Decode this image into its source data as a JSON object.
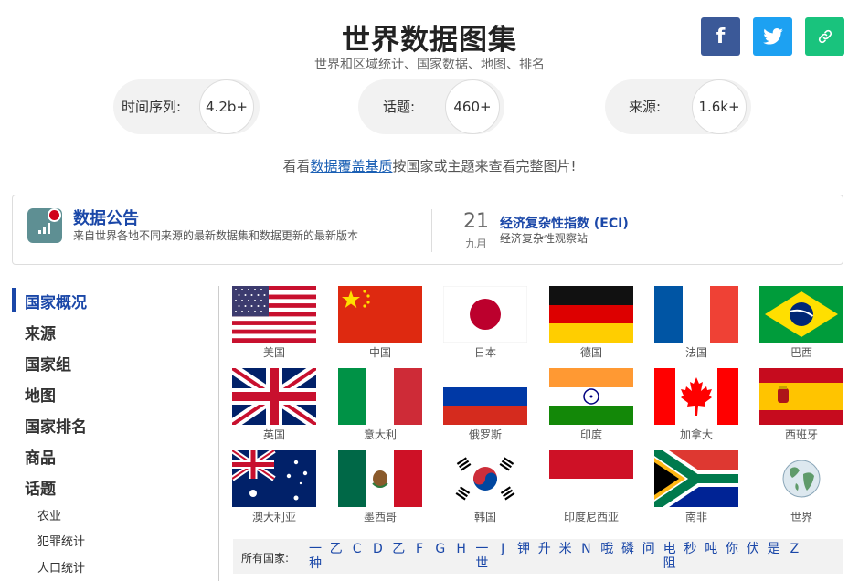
{
  "header": {
    "title": "世界数据图集",
    "subtitle": "世界和区域统计、国家数据、地图、排名"
  },
  "share": {
    "facebook_icon": "f",
    "colors": {
      "facebook": "#3b5998",
      "twitter": "#1da1f2",
      "link": "#19c37d"
    }
  },
  "stats": [
    {
      "label": "时间序列:",
      "value": "4.2b+"
    },
    {
      "label": "话题:",
      "value": "460+"
    },
    {
      "label": "来源:",
      "value": "1.6k+"
    }
  ],
  "coverage": {
    "prefix": "看看",
    "link": "数据覆盖基质",
    "suffix": "按国家或主题来查看完整图片!"
  },
  "notice": {
    "title": "数据公告",
    "desc": "来自世界各地不同来源的最新数据集和数据更新的最新版本",
    "day": "21",
    "month": "九月",
    "eci_title": "经济复杂性指数 (ECI)",
    "eci_sub": "经济复杂性观察站"
  },
  "sidebar": {
    "items": [
      "国家概况",
      "来源",
      "国家组",
      "地图",
      "国家排名",
      "商品",
      "话题"
    ],
    "subitems": [
      "农业",
      "犯罪统计",
      "人口统计"
    ]
  },
  "countries": [
    "美国",
    "中国",
    "日本",
    "德国",
    "法国",
    "巴西",
    "英国",
    "意大利",
    "俄罗斯",
    "印度",
    "加拿大",
    "西班牙",
    "澳大利亚",
    "墨西哥",
    "韩国",
    "印度尼西亚",
    "南非",
    "世界"
  ],
  "az": {
    "label": "所有国家:",
    "letters": [
      {
        "t": "一",
        "b": "种"
      },
      {
        "t": "乙"
      },
      {
        "t": "C"
      },
      {
        "t": "D"
      },
      {
        "t": "乙"
      },
      {
        "t": "F"
      },
      {
        "t": "G"
      },
      {
        "t": "H"
      },
      {
        "t": "一",
        "b": "世"
      },
      {
        "t": "J"
      },
      {
        "t": "钾"
      },
      {
        "t": "升"
      },
      {
        "t": "米"
      },
      {
        "t": "N"
      },
      {
        "t": "哦"
      },
      {
        "t": "磷"
      },
      {
        "t": "问"
      },
      {
        "t": "电",
        "b": "阻"
      },
      {
        "t": "秒"
      },
      {
        "t": "吨"
      },
      {
        "t": "你"
      },
      {
        "t": "伏"
      },
      {
        "t": "是"
      },
      {
        "t": "Z"
      }
    ]
  }
}
